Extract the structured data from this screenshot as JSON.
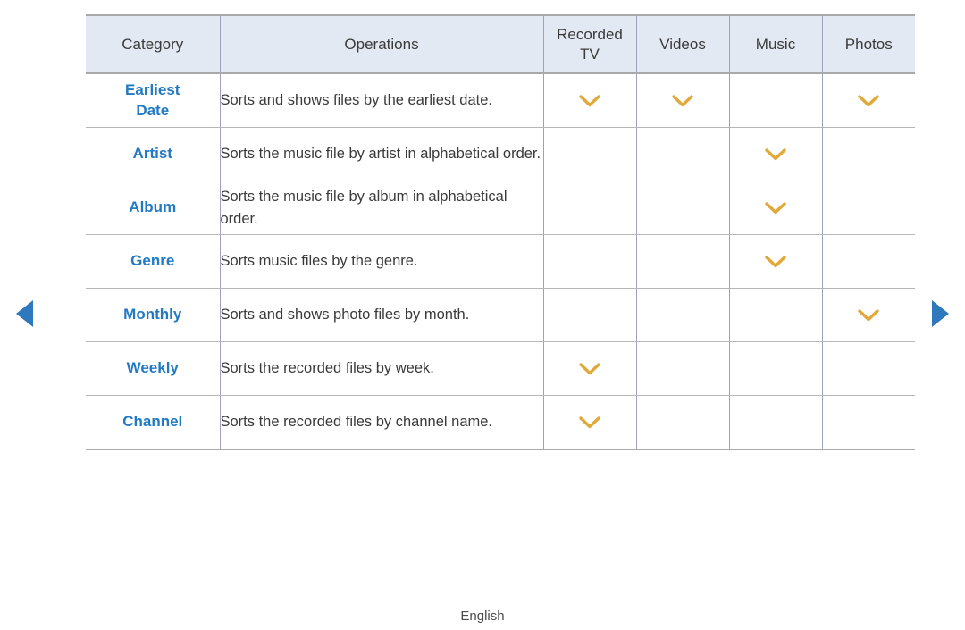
{
  "page": {
    "language_label": "English"
  },
  "navigation": {
    "prev_label": "Previous page",
    "next_label": "Next page",
    "prev_icon": "triangle-left-icon",
    "next_icon": "triangle-right-icon",
    "arrow_color": "#2E78BD"
  },
  "theme": {
    "header_bg": "#E3E9F2",
    "category_text": "#2279C4",
    "check_mark_color": "#E0A93A",
    "border_color": "#9AA3BB",
    "body_text": "#3A3A3A"
  },
  "table": {
    "columns": [
      {
        "key": "category",
        "label": "Category"
      },
      {
        "key": "operations",
        "label": "Operations"
      },
      {
        "key": "recorded_tv",
        "label": "Recorded TV"
      },
      {
        "key": "videos",
        "label": "Videos"
      },
      {
        "key": "music",
        "label": "Music"
      },
      {
        "key": "photos",
        "label": "Photos"
      }
    ],
    "header_recorded_tv_line1": "Recorded",
    "header_recorded_tv_line2": "TV",
    "mark_icon": "chevron-down-icon",
    "rows": [
      {
        "category": "Earliest Date",
        "category_line1": "Earliest",
        "category_line2": "Date",
        "operations": "Sorts and shows files by the earliest date.",
        "recorded_tv": true,
        "videos": true,
        "music": false,
        "photos": true
      },
      {
        "category": "Artist",
        "category_line1": "Artist",
        "category_line2": "",
        "operations": "Sorts the music file by artist in alphabetical order.",
        "recorded_tv": false,
        "videos": false,
        "music": true,
        "photos": false
      },
      {
        "category": "Album",
        "category_line1": "Album",
        "category_line2": "",
        "operations": "Sorts the music file by album in alphabetical order.",
        "recorded_tv": false,
        "videos": false,
        "music": true,
        "photos": false
      },
      {
        "category": "Genre",
        "category_line1": "Genre",
        "category_line2": "",
        "operations": "Sorts music files by the genre.",
        "recorded_tv": false,
        "videos": false,
        "music": true,
        "photos": false
      },
      {
        "category": "Monthly",
        "category_line1": "Monthly",
        "category_line2": "",
        "operations": "Sorts and shows photo files by month.",
        "recorded_tv": false,
        "videos": false,
        "music": false,
        "photos": true
      },
      {
        "category": "Weekly",
        "category_line1": "Weekly",
        "category_line2": "",
        "operations": "Sorts the recorded files by week.",
        "recorded_tv": true,
        "videos": false,
        "music": false,
        "photos": false
      },
      {
        "category": "Channel",
        "category_line1": "Channel",
        "category_line2": "",
        "operations": "Sorts the recorded files by channel name.",
        "recorded_tv": true,
        "videos": false,
        "music": false,
        "photos": false
      }
    ]
  }
}
